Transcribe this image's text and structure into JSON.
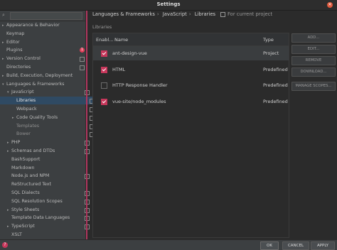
{
  "window": {
    "title": "Settings"
  },
  "search": {
    "placeholder": ""
  },
  "sidebar": {
    "items": [
      {
        "label": "Appearance & Behavior",
        "indent": 0,
        "arrow": "▸",
        "copy": false
      },
      {
        "label": "Keymap",
        "indent": 0,
        "arrow": "",
        "copy": false
      },
      {
        "label": "Editor",
        "indent": 0,
        "arrow": "▸",
        "copy": false
      },
      {
        "label": "Plugins",
        "indent": 0,
        "arrow": "",
        "copy": false,
        "badge": "1"
      },
      {
        "label": "Version Control",
        "indent": 0,
        "arrow": "▸",
        "copy": true
      },
      {
        "label": "Directories",
        "indent": 0,
        "arrow": "",
        "copy": true
      },
      {
        "label": "Build, Execution, Deployment",
        "indent": 0,
        "arrow": "▸",
        "copy": false
      },
      {
        "label": "Languages & Frameworks",
        "indent": 0,
        "arrow": "▾",
        "copy": false
      },
      {
        "label": "JavaScript",
        "indent": 1,
        "arrow": "▾",
        "copy": true
      },
      {
        "label": "Libraries",
        "indent": 2,
        "arrow": "",
        "copy": true,
        "selected": true
      },
      {
        "label": "Webpack",
        "indent": 2,
        "arrow": "",
        "copy": true
      },
      {
        "label": "Code Quality Tools",
        "indent": 2,
        "arrow": "▸",
        "copy": true
      },
      {
        "label": "Templates",
        "indent": 2,
        "arrow": "",
        "copy": true,
        "dim": true
      },
      {
        "label": "Bower",
        "indent": 2,
        "arrow": "",
        "copy": true,
        "dim": true
      },
      {
        "label": "PHP",
        "indent": 1,
        "arrow": "▸",
        "copy": true
      },
      {
        "label": "Schemas and DTDs",
        "indent": 1,
        "arrow": "▸",
        "copy": true
      },
      {
        "label": "BashSupport",
        "indent": 1,
        "arrow": "",
        "copy": false
      },
      {
        "label": "Markdown",
        "indent": 1,
        "arrow": "",
        "copy": false
      },
      {
        "label": "Node.js and NPM",
        "indent": 1,
        "arrow": "",
        "copy": true
      },
      {
        "label": "ReStructured Text",
        "indent": 1,
        "arrow": "",
        "copy": false
      },
      {
        "label": "SQL Dialects",
        "indent": 1,
        "arrow": "",
        "copy": true
      },
      {
        "label": "SQL Resolution Scopes",
        "indent": 1,
        "arrow": "",
        "copy": true
      },
      {
        "label": "Style Sheets",
        "indent": 1,
        "arrow": "▸",
        "copy": true
      },
      {
        "label": "Template Data Languages",
        "indent": 1,
        "arrow": "",
        "copy": true
      },
      {
        "label": "TypeScript",
        "indent": 1,
        "arrow": "▸",
        "copy": true
      },
      {
        "label": "XSLT",
        "indent": 1,
        "arrow": "",
        "copy": false
      }
    ]
  },
  "breadcrumb": {
    "parts": [
      "Languages & Frameworks",
      "JavaScript",
      "Libraries"
    ],
    "scope": "For current project"
  },
  "section": {
    "label": "Libraries"
  },
  "table": {
    "headers": {
      "enabled": "Enabl...",
      "name": "Name",
      "type": "Type"
    },
    "rows": [
      {
        "name": "ant-design-vue",
        "type": "Project",
        "checked": true,
        "selected": true
      },
      {
        "name": "HTML",
        "type": "Predefined",
        "checked": true
      },
      {
        "name": "HTTP Response Handler",
        "type": "Predefined",
        "checked": false
      },
      {
        "name": "vue-site/node_modules",
        "type": "Predefined",
        "checked": true
      }
    ]
  },
  "buttons": {
    "add": "ADD...",
    "edit": "EDIT...",
    "remove": "REMOVE",
    "download": "DOWNLOAD...",
    "manage": "MANAGE SCOPES..."
  },
  "footer": {
    "ok": "OK",
    "cancel": "CANCEL",
    "apply": "APPLY"
  },
  "colors": {
    "accent": "#c7375b",
    "selection": "#2f4a63"
  }
}
